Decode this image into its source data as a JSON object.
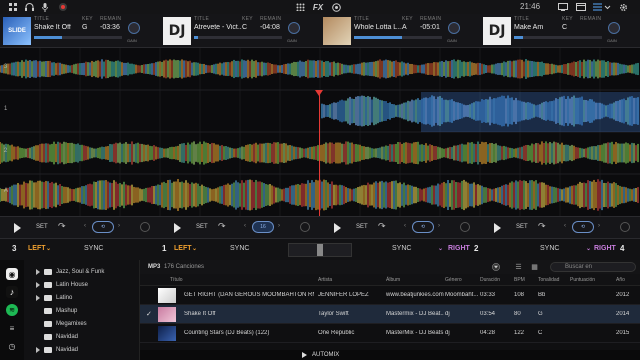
{
  "topbar": {
    "time": "21:46",
    "fx_label": "FX"
  },
  "decks": [
    {
      "number": "1",
      "col_title": "TITLE",
      "col_key": "KEY",
      "col_rem": "REMAIN",
      "title": "Shake It Off",
      "key": "G",
      "remaining": "-03:36",
      "progress": 0.32,
      "art": "blue"
    },
    {
      "number": "2",
      "col_title": "TITLE",
      "col_key": "KEY",
      "col_rem": "REMAIN",
      "title": "Atrevete - Vict...",
      "key": "C",
      "remaining": "-04:08",
      "progress": 0.05,
      "art": "dj"
    },
    {
      "number": "3",
      "col_title": "TITLE",
      "col_key": "KEY",
      "col_rem": "REMAIN",
      "title": "Whole Lotta L...",
      "key": "A",
      "remaining": "-05:01",
      "progress": 0.55,
      "art": "photo"
    },
    {
      "number": "4",
      "col_title": "TITLE",
      "col_key": "KEY",
      "col_rem": "REMAIN",
      "title": "Make Am",
      "key": "C",
      "remaining": "",
      "progress": 0.1,
      "art": "dj"
    }
  ],
  "deck_small_label": "GAIN",
  "waveform_labels": [
    "3",
    "1",
    "2",
    "A"
  ],
  "transport": {
    "set_label": "SET",
    "loop_value": "16"
  },
  "mixer": {
    "left_deck_a": "3",
    "left_label_a": "LEFT",
    "sync_a": "SYNC",
    "left_deck_b": "1",
    "left_label_b": "LEFT",
    "sync_b": "SYNC",
    "sync_c": "SYNC",
    "right_label_c": "RIGHT",
    "right_deck_c": "2",
    "sync_d": "SYNC",
    "right_label_d": "RIGHT",
    "right_deck_d": "4"
  },
  "folders": [
    "Jazz, Soul & Funk",
    "Latin House",
    "Latino",
    "Mashup",
    "Megamixes",
    "Navidad",
    "Navidad"
  ],
  "list_header": {
    "format": "MP3",
    "count": "176 Canciones",
    "search_placeholder": "Buscar en"
  },
  "columns": {
    "title": "Título",
    "artist": "Artista",
    "album": "Álbum",
    "genre": "Género",
    "duration": "Duración",
    "bpm": "BPM",
    "key": "Tonalidad",
    "rating": "Puntuación",
    "year": "Año"
  },
  "tracks": [
    {
      "title": "GET RIGHT (DAN GEROUS MOOMBAHTON RMX)(...",
      "artist": "JENNIFER LOPEZ",
      "album": "www.beatjunkies.com",
      "genre": "Moombaht...",
      "duration": "03:33",
      "bpm": "108",
      "key": "Bb",
      "rating": "",
      "year": "2012",
      "selected": false,
      "art": "beat"
    },
    {
      "title": "Shake It Off",
      "artist": "Taylor Swift",
      "album": "Mastermix - DJ Beat...",
      "genre": "dj",
      "duration": "03:54",
      "bpm": "80",
      "key": "G",
      "rating": "",
      "year": "2014",
      "selected": true,
      "art": "tay"
    },
    {
      "title": "Counting Stars (DJ Beats) (122)",
      "artist": "One Republic",
      "album": "MasterMix - DJ Beats ...",
      "genre": "dj",
      "duration": "04:28",
      "bpm": "122",
      "key": "C",
      "rating": "",
      "year": "2015",
      "selected": false,
      "art": "onerep"
    }
  ],
  "automix_label": "AUTOMIX",
  "colors": {
    "accent_blue": "#4d8fd6",
    "left": "#f0a030",
    "right": "#c77ddc",
    "playhead": "#e53935"
  }
}
